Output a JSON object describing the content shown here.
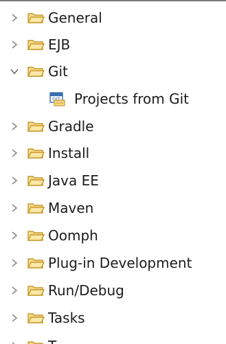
{
  "tree": {
    "items": [
      {
        "label": "General",
        "expanded": false
      },
      {
        "label": "EJB",
        "expanded": false
      },
      {
        "label": "Git",
        "expanded": true
      },
      {
        "label": "Projects from Git",
        "child": true,
        "icon": "git-project-icon"
      },
      {
        "label": "Gradle",
        "expanded": false
      },
      {
        "label": "Install",
        "expanded": false
      },
      {
        "label": "Java EE",
        "expanded": false
      },
      {
        "label": "Maven",
        "expanded": false
      },
      {
        "label": "Oomph",
        "expanded": false
      },
      {
        "label": "Plug-in Development",
        "expanded": false
      },
      {
        "label": "Run/Debug",
        "expanded": false
      },
      {
        "label": "Tasks",
        "expanded": false
      },
      {
        "label": "T",
        "expanded": false
      }
    ]
  },
  "colors": {
    "folder_fill": "#f6d98a",
    "folder_stroke": "#c79a2c",
    "chevron": "#8a8a8a",
    "git_badge": "#3a6fb0",
    "border": "#7a7a7a"
  },
  "icons": {
    "collapsed": "chevron-right-icon",
    "expanded": "chevron-down-icon",
    "folder": "folder-icon",
    "git": "git-project-icon"
  }
}
